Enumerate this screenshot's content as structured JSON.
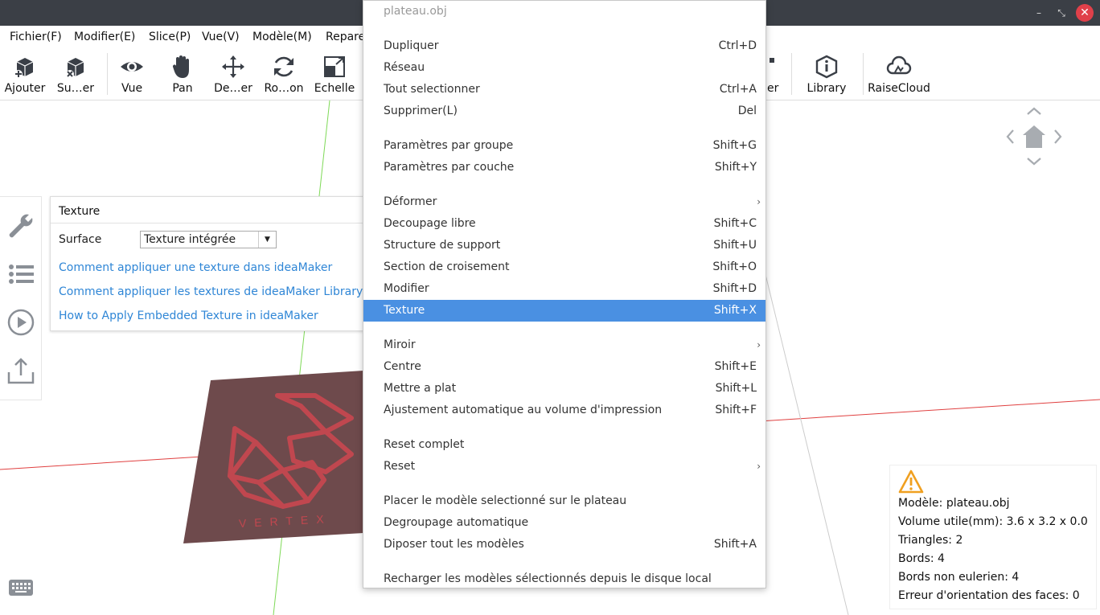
{
  "window": {
    "min_icon": "minimize-icon",
    "restore_icon": "restore-icon",
    "close_icon": "close-icon"
  },
  "menubar": [
    "Fichier(F)",
    "Modifier(E)",
    "Slice(P)",
    "Vue(V)",
    "Modèle(M)",
    "Repare"
  ],
  "toolbar": {
    "left": [
      {
        "label": "Ajouter",
        "icon": "add-cube-icon"
      },
      {
        "label": "Su…er",
        "icon": "delete-cube-icon"
      },
      {
        "label": "Vue",
        "icon": "eye-icon"
      },
      {
        "label": "Pan",
        "icon": "hand-icon"
      },
      {
        "label": "De…er",
        "icon": "move-icon"
      },
      {
        "label": "Ro…on",
        "icon": "rotate-icon"
      },
      {
        "label": "Echelle",
        "icon": "scale-icon"
      }
    ],
    "right": [
      {
        "label": ".er",
        "icon": "edit-icon"
      },
      {
        "label": "Library",
        "icon": "library-icon"
      },
      {
        "label": "RaiseCloud",
        "icon": "cloud-icon"
      }
    ]
  },
  "texture_panel": {
    "title": "Texture",
    "surface_label": "Surface",
    "surface_value": "Texture intégrée",
    "links": [
      "Comment appliquer une texture dans ideaMaker",
      "Comment appliquer les textures de ideaMaker Library da",
      "How to Apply Embedded Texture in ideaMaker"
    ]
  },
  "model_text": "VERTEX",
  "info": {
    "warning_icon": "warning-icon",
    "lines": [
      "Modèle: plateau.obj",
      "Volume utile(mm): 3.6 x 3.2 x 0.0",
      "Triangles: 2",
      "Bords: 4",
      "Bords non eulerien: 4",
      "Erreur d'orientation des faces: 0"
    ]
  },
  "context_menu": {
    "header": "plateau.obj",
    "items": [
      {
        "label": "Dupliquer",
        "shortcut": "Ctrl+D"
      },
      {
        "label": "Réseau",
        "shortcut": ""
      },
      {
        "label": "Tout selectionner",
        "shortcut": "Ctrl+A"
      },
      {
        "label": "Supprimer(L)",
        "shortcut": "Del"
      },
      {
        "label": "Paramètres par groupe",
        "shortcut": "Shift+G"
      },
      {
        "label": "Paramètres par couche",
        "shortcut": "Shift+Y"
      },
      {
        "label": "Déformer",
        "shortcut": "›"
      },
      {
        "label": "Decoupage libre",
        "shortcut": "Shift+C"
      },
      {
        "label": "Structure de support",
        "shortcut": "Shift+U"
      },
      {
        "label": "Section de croisement",
        "shortcut": "Shift+O"
      },
      {
        "label": "Modifier",
        "shortcut": "Shift+D"
      },
      {
        "label": "Texture",
        "shortcut": "Shift+X"
      },
      {
        "label": "Miroir",
        "shortcut": "›"
      },
      {
        "label": "Centre",
        "shortcut": "Shift+E"
      },
      {
        "label": "Mettre a plat",
        "shortcut": "Shift+L"
      },
      {
        "label": "Ajustement automatique au volume d'impression",
        "shortcut": "Shift+F"
      },
      {
        "label": "Reset complet",
        "shortcut": ""
      },
      {
        "label": "Reset",
        "shortcut": "›"
      },
      {
        "label": "Placer le modèle selectionné sur le plateau",
        "shortcut": ""
      },
      {
        "label": "Degroupage automatique",
        "shortcut": ""
      },
      {
        "label": "Diposer tout les modèles",
        "shortcut": "Shift+A"
      },
      {
        "label": "Recharger les modèles sélectionnés depuis le disque local",
        "shortcut": ""
      }
    ]
  },
  "colors": {
    "highlight": "#4a90e2",
    "link": "#2f86d6",
    "model": "#6e4a4c",
    "model_lines": "#c0474f"
  }
}
